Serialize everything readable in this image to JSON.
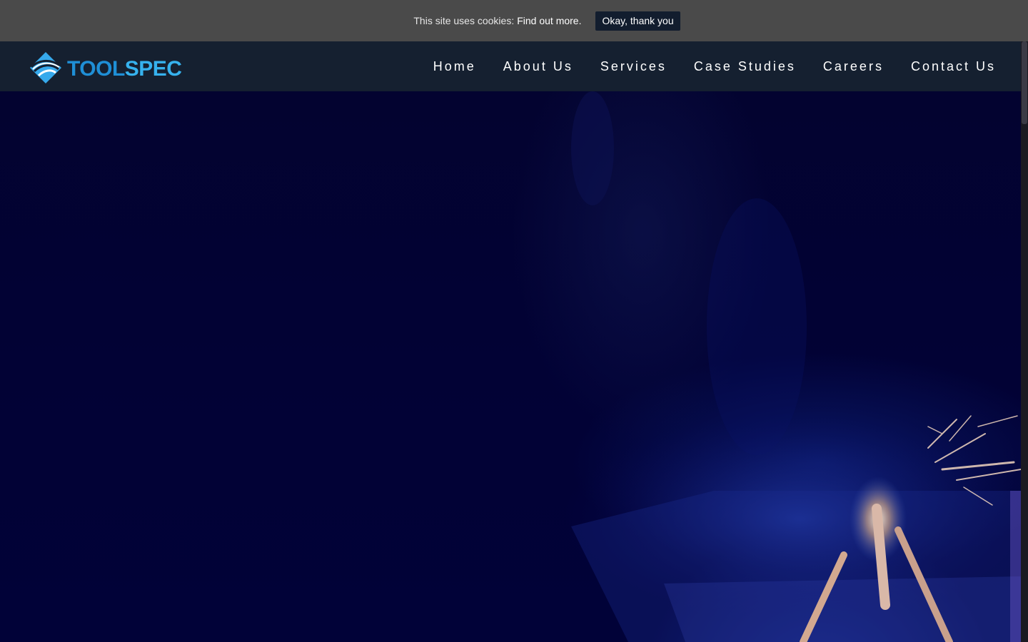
{
  "cookie_banner": {
    "message": "This site uses cookies:",
    "link_label": "Find out more.",
    "accept_label": "Okay, thank you"
  },
  "header": {
    "logo": {
      "text_part1": "TOOL",
      "text_part2": "SPEC",
      "icon": "toolspec-diamond-logo-icon"
    },
    "nav": [
      {
        "label": "Home"
      },
      {
        "label": "About Us"
      },
      {
        "label": "Services"
      },
      {
        "label": "Case Studies"
      },
      {
        "label": "Careers"
      },
      {
        "label": "Contact Us"
      }
    ]
  },
  "hero": {
    "image": "welding-sparks-background"
  },
  "colors": {
    "cookie_bar_bg": "#4a4a4a",
    "header_bg": "#152030",
    "accent_blue": "#1f8fd6",
    "accent_light_blue": "#36b2ee",
    "hero_bg": "#02023a"
  }
}
